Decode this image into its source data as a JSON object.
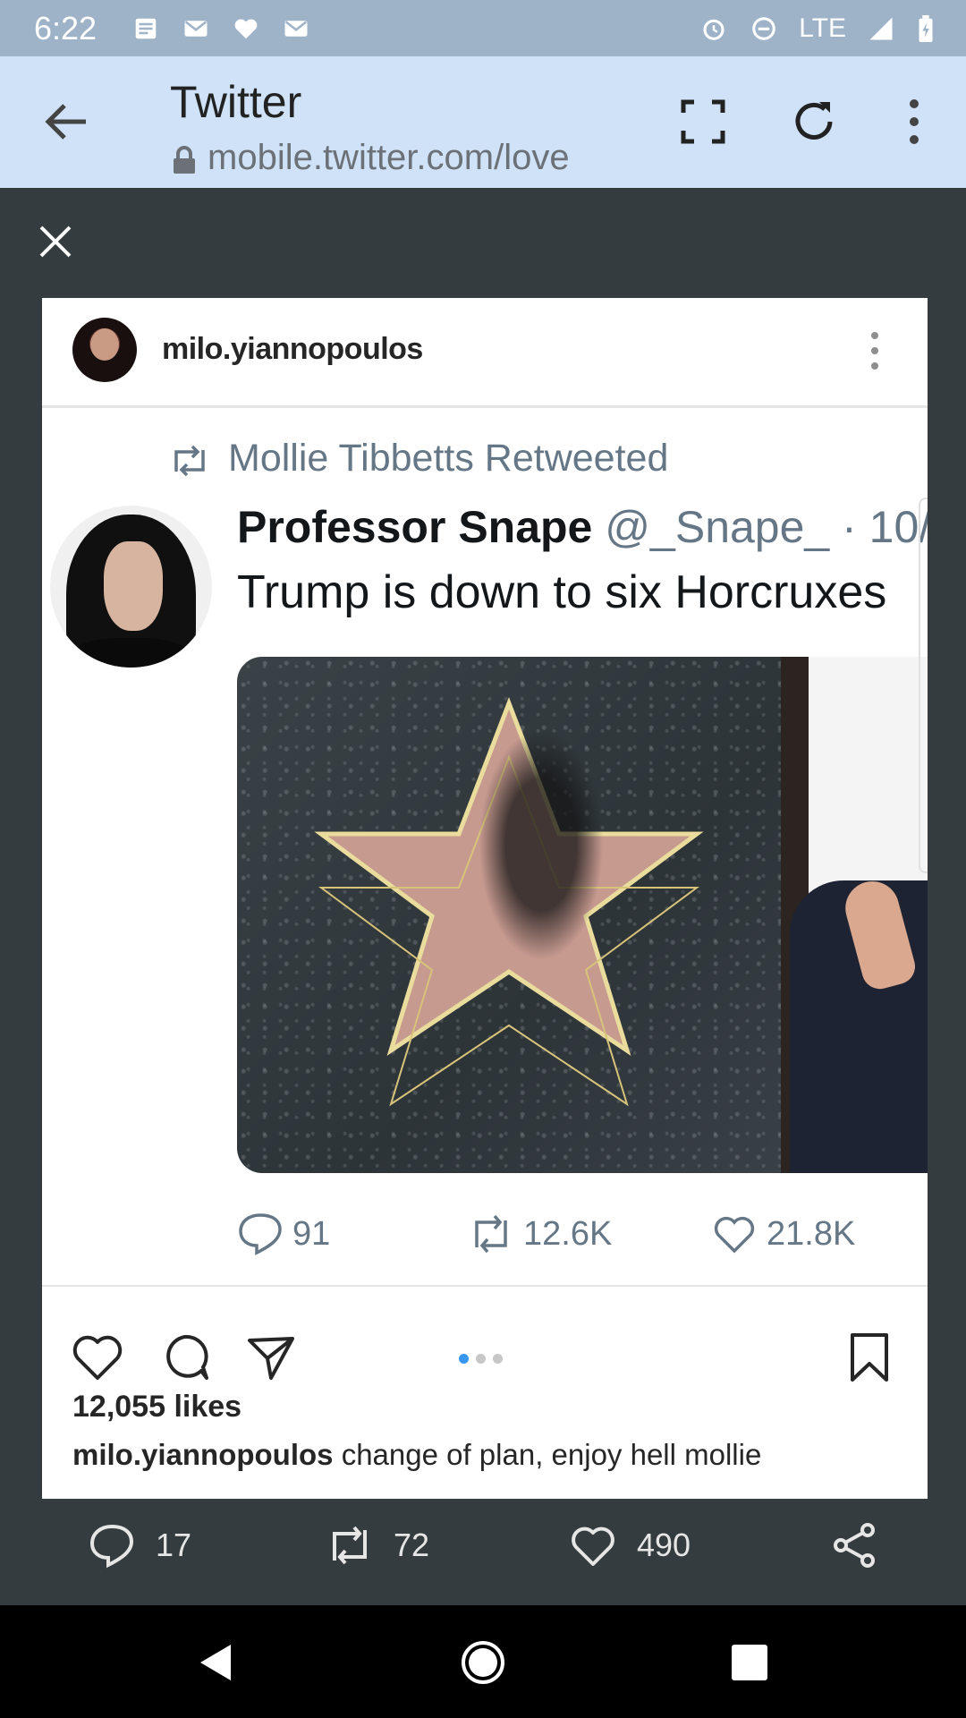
{
  "status_bar": {
    "time": "6:22",
    "network": "LTE",
    "icons": [
      "notes-icon",
      "mail-icon",
      "heart-icon",
      "mail-icon",
      "alarm-icon",
      "do-not-disturb-icon",
      "signal-icon",
      "battery-icon"
    ]
  },
  "browser": {
    "title": "Twitter",
    "url": "mobile.twitter.com/love",
    "icons": [
      "back-arrow-icon",
      "lock-icon",
      "fullscreen-icon",
      "reload-icon",
      "overflow-menu-icon"
    ]
  },
  "viewer": {
    "close_icon": "close-icon"
  },
  "instagram_post": {
    "username": "milo.yiannopoulos",
    "likes": "12,055 likes",
    "caption_user": "milo.yiannopoulos",
    "caption_text": "change of plan, enjoy hell mollie",
    "carousel": {
      "count": 3,
      "active_index": 0
    }
  },
  "embedded_tweet": {
    "retweet_label": "Mollie Tibbetts Retweeted",
    "name": "Professor Snape",
    "handle": "@_Snape_ · 10/",
    "text": "Trump is down to six Horcruxes",
    "replies": "91",
    "retweets": "12.6K",
    "likes": "21.8K"
  },
  "tweet_actions": {
    "replies": "17",
    "retweets": "72",
    "likes": "490"
  },
  "colors": {
    "status_bar": "#9fb3c8",
    "toolbar": "#cfe2f7",
    "background": "#343c40",
    "twitter_gray": "#657786",
    "carousel_active": "#3897f0"
  }
}
